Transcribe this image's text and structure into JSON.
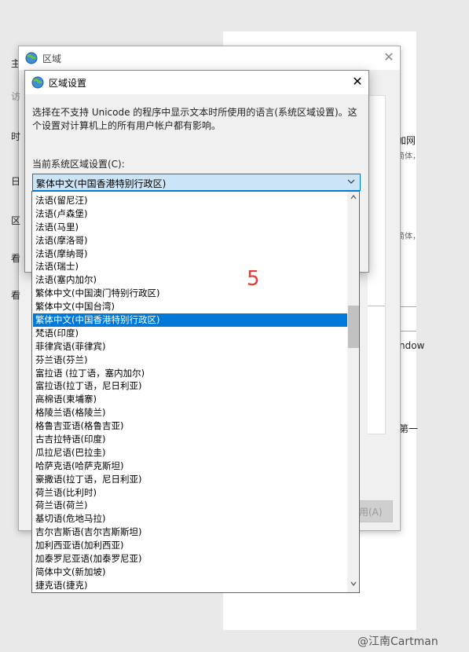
{
  "background": {
    "right_fragments": [
      "加网",
      "简体，",
      "简体，",
      "ndow",
      "第一"
    ],
    "left_fragments": [
      "主",
      "访",
      "时",
      "日",
      "区",
      "看",
      "看"
    ]
  },
  "region_window": {
    "title": "区域",
    "close_glyph": "✕",
    "apply_button_fragment": "用(A)"
  },
  "dialog": {
    "title": "区域设置",
    "close_glyph": "✕",
    "description": "选择在不支持 Unicode 的程序中显示文本时所使用的语言(系统区域设置)。这个设置对计算机上的所有用户帐户都有影响。",
    "current_label": "当前系统区域设置(C):",
    "selected_value": "繁体中文(中国香港特别行政区)"
  },
  "dropdown": {
    "items": [
      "法语(留尼汪)",
      "法语(卢森堡)",
      "法语(马里)",
      "法语(摩洛哥)",
      "法语(摩纳哥)",
      "法语(瑞士)",
      "法语(塞内加尔)",
      "繁体中文(中国澳门特别行政区)",
      "繁体中文(中国台湾)",
      "繁体中文(中国香港特别行政区)",
      "梵语(印度)",
      "菲律宾语(菲律宾)",
      "芬兰语(芬兰)",
      "富拉语 (拉丁语，塞内加尔)",
      "富拉语(拉丁语，尼日利亚)",
      "高棉语(柬埔寨)",
      "格陵兰语(格陵兰)",
      "格鲁吉亚语(格鲁吉亚)",
      "古吉拉特语(印度)",
      "瓜拉尼语(巴拉圭)",
      "哈萨克语(哈萨克斯坦)",
      "豪撒语(拉丁语，尼日利亚)",
      "荷兰语(比利时)",
      "荷兰语(荷兰)",
      "基切语(危地马拉)",
      "吉尔吉斯语(吉尔吉斯斯坦)",
      "加利西亚语(加利西亚)",
      "加泰罗尼亚语(加泰罗尼亚)",
      "简体中文(新加坡)",
      "捷克语(捷克)"
    ],
    "selected_index": 9,
    "up_arrow": "▲",
    "down_arrow": "▼"
  },
  "annotation": "5",
  "watermark": "@江南Cartman",
  "colors": {
    "accent": "#0078d7",
    "select_bg": "#cce4f7",
    "annotation": "#e53935"
  }
}
